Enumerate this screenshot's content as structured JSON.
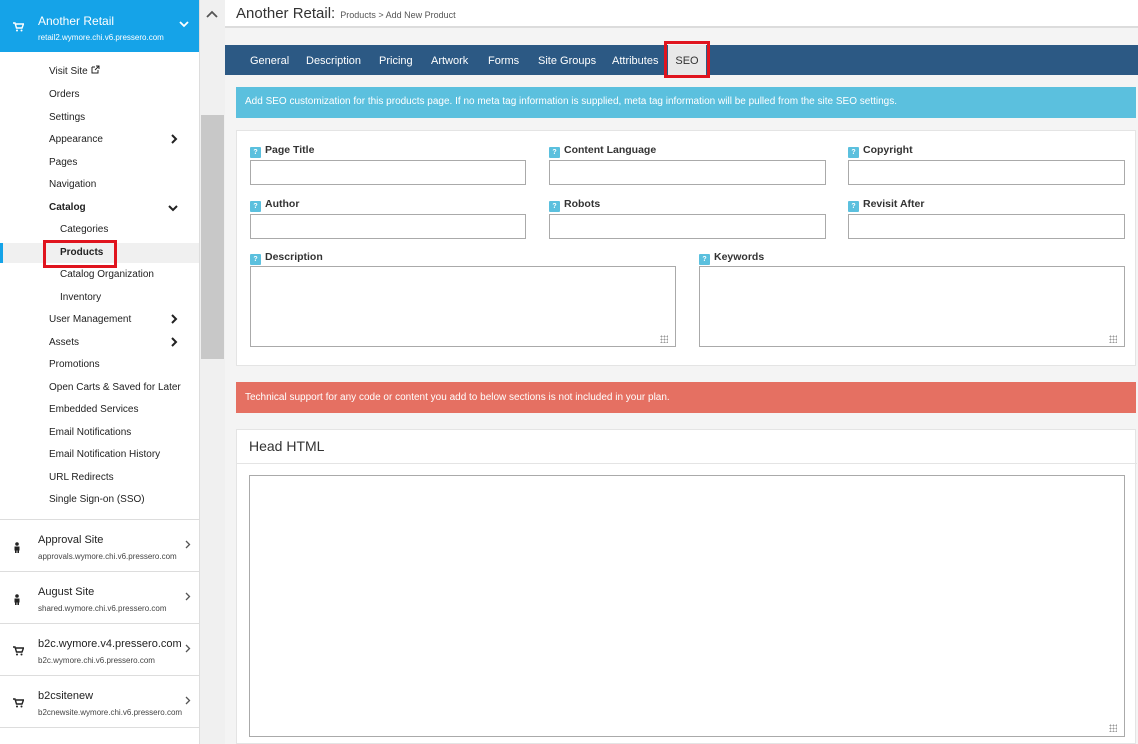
{
  "sidebar": {
    "active_site": {
      "name": "Another Retail",
      "url": "retail2.wymore.chi.v6.pressero.com"
    },
    "menu": [
      {
        "label": "Visit Site",
        "key": "visit-site"
      },
      {
        "label": "Orders",
        "key": "orders"
      },
      {
        "label": "Settings",
        "key": "settings"
      },
      {
        "label": "Appearance",
        "key": "appearance"
      },
      {
        "label": "Pages",
        "key": "pages"
      },
      {
        "label": "Navigation",
        "key": "navigation"
      },
      {
        "label": "Catalog",
        "key": "catalog"
      },
      {
        "label": "Categories",
        "key": "categories"
      },
      {
        "label": "Products",
        "key": "products"
      },
      {
        "label": "Catalog Organization",
        "key": "catalog-organization"
      },
      {
        "label": "Inventory",
        "key": "inventory"
      },
      {
        "label": "User Management",
        "key": "user-management"
      },
      {
        "label": "Assets",
        "key": "assets"
      },
      {
        "label": "Promotions",
        "key": "promotions"
      },
      {
        "label": "Open Carts & Saved for Later",
        "key": "open-carts"
      },
      {
        "label": "Embedded Services",
        "key": "embedded-services"
      },
      {
        "label": "Email Notifications",
        "key": "email-notifications"
      },
      {
        "label": "Email Notification History",
        "key": "email-notification-history"
      },
      {
        "label": "URL Redirects",
        "key": "url-redirects"
      },
      {
        "label": "Single Sign-on (SSO)",
        "key": "sso"
      }
    ],
    "other_sites": [
      {
        "name": "Approval Site",
        "url": "approvals.wymore.chi.v6.pressero.com",
        "icon": "person-icon"
      },
      {
        "name": "August Site",
        "url": "shared.wymore.chi.v6.pressero.com",
        "icon": "person-icon"
      },
      {
        "name": "b2c.wymore.v4.pressero.com",
        "url": "b2c.wymore.chi.v6.pressero.com",
        "icon": "cart-icon"
      },
      {
        "name": "b2csitenew",
        "url": "b2cnewsite.wymore.chi.v6.pressero.com",
        "icon": "cart-icon"
      }
    ]
  },
  "header": {
    "title": "Another Retail:",
    "breadcrumb_section": "Products",
    "breadcrumb_sep": ">",
    "breadcrumb_page": "Add New Product"
  },
  "tabs": [
    {
      "label": "General"
    },
    {
      "label": "Description"
    },
    {
      "label": "Pricing"
    },
    {
      "label": "Artwork"
    },
    {
      "label": "Forms"
    },
    {
      "label": "Site Groups"
    },
    {
      "label": "Attributes"
    },
    {
      "label": "SEO"
    }
  ],
  "active_tab": "SEO",
  "seo": {
    "info_message": "Add SEO customization for this products page. If no meta tag information is supplied, meta tag information will be pulled from the site SEO settings.",
    "help_glyph": "?",
    "fields": {
      "page_title": {
        "label": "Page Title",
        "value": ""
      },
      "content_language": {
        "label": "Content Language",
        "value": ""
      },
      "copyright": {
        "label": "Copyright",
        "value": ""
      },
      "author": {
        "label": "Author",
        "value": ""
      },
      "robots": {
        "label": "Robots",
        "value": ""
      },
      "revisit_after": {
        "label": "Revisit After",
        "value": ""
      },
      "description": {
        "label": "Description",
        "value": ""
      },
      "keywords": {
        "label": "Keywords",
        "value": ""
      }
    },
    "warning_message": "Technical support for any code or content you add to below sections is not included in your plan.",
    "head_html": {
      "title": "Head HTML",
      "value": ""
    }
  },
  "colors": {
    "sidebar_active": "#15a3e8",
    "tab_bar": "#2c5984",
    "info": "#5bc0de",
    "warning": "#e57062",
    "highlight": "#e0141e"
  }
}
